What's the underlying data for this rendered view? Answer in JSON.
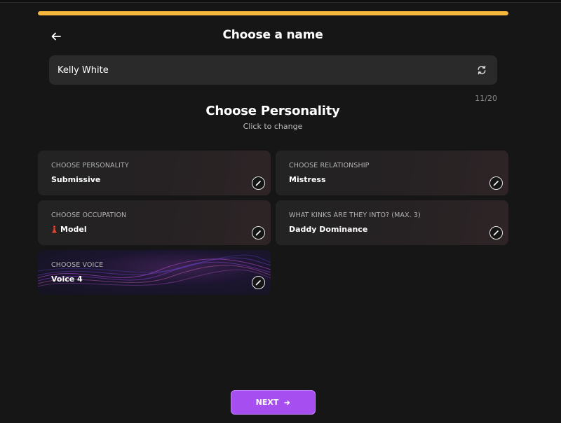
{
  "progress": {
    "fraction": 1.0,
    "color": "#f5b83d"
  },
  "header": {
    "back_icon": "arrow-left-icon",
    "title": "Choose a name"
  },
  "name_field": {
    "value": "Kelly White",
    "refresh_icon": "refresh-icon",
    "char_count": "11/20"
  },
  "personality_section": {
    "title": "Choose Personality",
    "subtitle": "Click to change"
  },
  "cards": {
    "personality": {
      "label": "CHOOSE PERSONALITY",
      "value": "Submissive"
    },
    "relationship": {
      "label": "CHOOSE RELATIONSHIP",
      "value": "Mistress"
    },
    "occupation": {
      "label": "CHOOSE OCCUPATION",
      "value": "Model",
      "icon": "model-figure-icon"
    },
    "kinks": {
      "label": "WHAT KINKS ARE THEY INTO? (MAX. 3)",
      "value": "Daddy Dominance"
    },
    "voice": {
      "label": "CHOOSE VOICE",
      "value": "Voice 4"
    }
  },
  "edit_icon": "pencil-icon",
  "next_button": {
    "label": "NEXT",
    "icon": "arrow-right-icon",
    "color": "#a64ef0"
  }
}
